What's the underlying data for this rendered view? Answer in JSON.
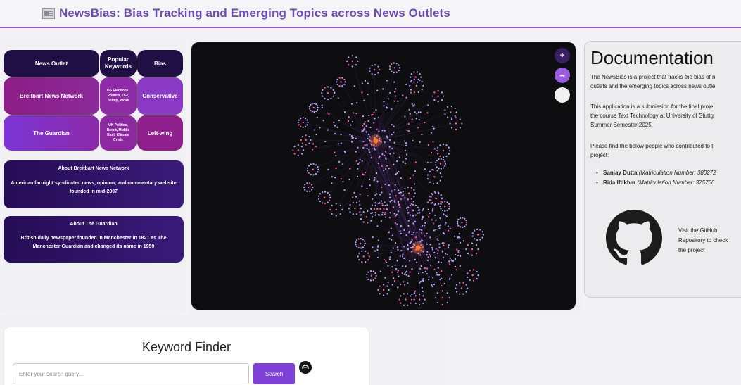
{
  "header": {
    "icon": "newspaper-icon",
    "title": "NewsBias: Bias Tracking and Emerging Topics across News Outlets"
  },
  "bias_table": {
    "headers": [
      "News Outlet",
      "Popular Keywords",
      "Bias"
    ],
    "rows": [
      {
        "outlet": "Breitbart News Network",
        "keywords": "US Elections, Politics, DEI, Trump, Woke",
        "bias": "Conservative"
      },
      {
        "outlet": "The Guardian",
        "keywords": "UK Politics, Brexit, Middle East, Climate Crisis",
        "bias": "Left-wing"
      }
    ]
  },
  "about": [
    {
      "title": "About Breitbart News Network",
      "body": "American far-right syndicated news, opinion, and commentary website founded in mid-2007"
    },
    {
      "title": "About The Guardian",
      "body": "British daily newspaper founded in Manchester in 1821 as The Manchester Guardian and changed its name in 1959"
    }
  ],
  "graph": {
    "zoom_in_label": "+",
    "zoom_out_label": "−",
    "colors": {
      "background": "#0e0d10",
      "node": "#b9a7ff",
      "node_accent": "#ff5fa8",
      "hub": "#ff7a2a",
      "edge": "#6b3aa6"
    }
  },
  "documentation": {
    "title": "Documentation",
    "para1": [
      "The NewsBias is a project that tracks the bias of n",
      "outlets and the emerging topics across news outle"
    ],
    "para2": [
      "This application is a submission for the final proje",
      "the course Text Technology at University of Stuttg",
      "Summer Semester 2025."
    ],
    "para3": [
      "Please find the below people who contributed to t",
      "project:"
    ],
    "contributors": [
      {
        "name": "Sanjay Dutta",
        "detail": "(Matriculation Number: 380272"
      },
      {
        "name": "Rida Iftikhar",
        "detail": "(Matriculation Number: 375766"
      }
    ],
    "github_icon": "github-icon",
    "github_text": [
      "Visit the GitHub",
      "Repository to check",
      "the project"
    ]
  },
  "keyword_finder": {
    "title": "Keyword Finder",
    "placeholder": "Enter your search query...",
    "button_label": "Search",
    "icon": "chat-icon"
  }
}
